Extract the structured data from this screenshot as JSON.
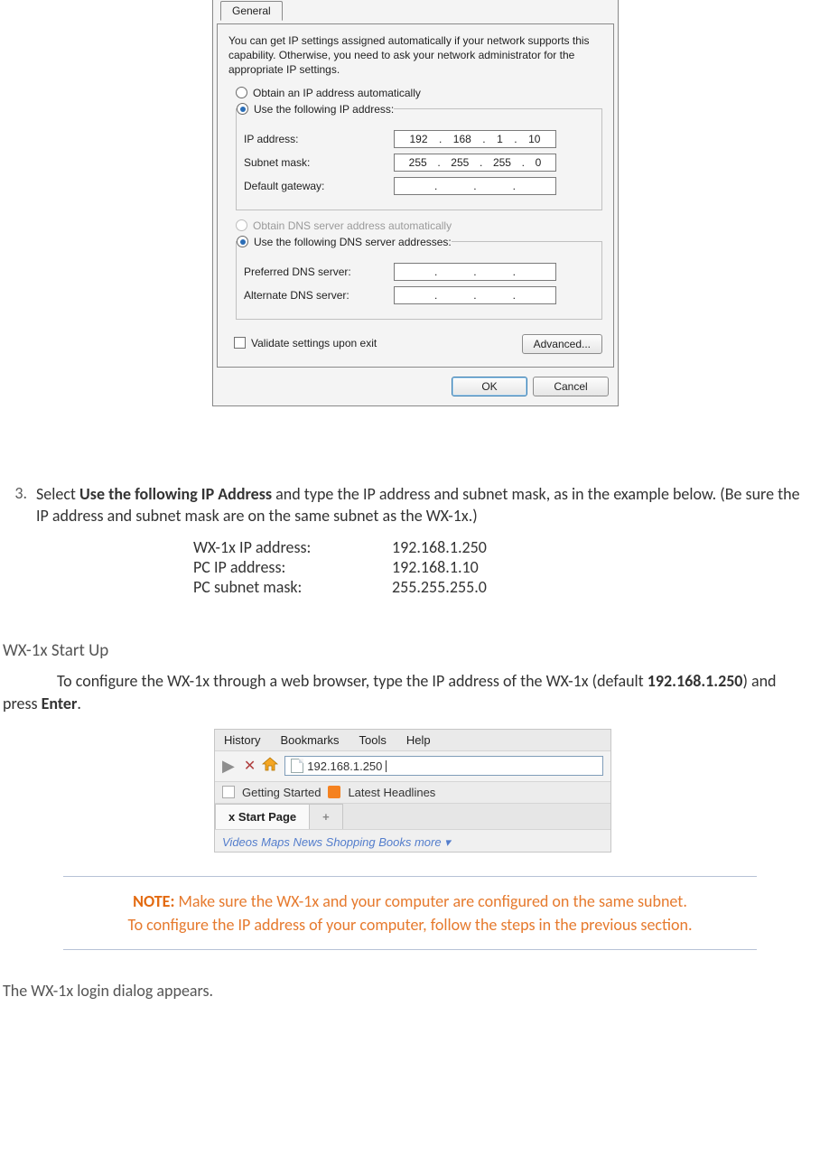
{
  "dialog": {
    "tab": "General",
    "intro": "You can get IP settings assigned automatically if your network supports this capability. Otherwise, you need to ask your network administrator for the appropriate IP settings.",
    "radio_obtain_ip": "Obtain an IP address automatically",
    "radio_use_ip": "Use the following IP address:",
    "ip_label": "IP address:",
    "ip_value_a": "192",
    "ip_value_b": "168",
    "ip_value_c": "1",
    "ip_value_d": "10",
    "subnet_label": "Subnet mask:",
    "subnet_a": "255",
    "subnet_b": "255",
    "subnet_c": "255",
    "subnet_d": "0",
    "gateway_label": "Default gateway:",
    "radio_obtain_dns": "Obtain DNS server address automatically",
    "radio_use_dns": "Use the following DNS server addresses:",
    "pref_dns_label": "Preferred DNS server:",
    "alt_dns_label": "Alternate DNS server:",
    "validate_label": "Validate settings upon exit",
    "advanced_btn": "Advanced...",
    "ok_btn": "OK",
    "cancel_btn": "Cancel"
  },
  "step3": {
    "num": "3.",
    "text_a": "Select ",
    "text_b": "Use the following IP Address",
    "text_c": " and type the IP address and subnet mask, as in the example below. (Be sure the IP address and subnet mask are on the same subnet as the WX-1x.)"
  },
  "table": {
    "r1k": "WX-1x IP address:",
    "r1v": "192.168.1.250",
    "r2k": "PC IP address:",
    "r2v": "192.168.1.10",
    "r3k": "PC subnet mask:",
    "r3v": "255.255.255.0"
  },
  "startup_heading": "WX-1x Start Up",
  "startup_p_a": "To configure the WX-1x through a web browser, type the IP address of the WX-1x (default ",
  "startup_p_b": "192.168.1.250",
  "startup_p_c": ") and press ",
  "startup_p_d": "Enter",
  "startup_p_e": ".",
  "browser": {
    "menu_history": "History",
    "menu_bookmarks": "Bookmarks",
    "menu_tools": "Tools",
    "menu_help": "Help",
    "url": "192.168.1.250",
    "bm1": "Getting Started",
    "bm2": "Latest Headlines",
    "tab1": "x Start Page",
    "tab2": "+",
    "links": "Videos   Maps   News   Shopping   Books   more ▾"
  },
  "note": {
    "label": "NOTE:",
    "l1": " Make sure the WX-1x and your computer are configured on the same subnet.",
    "l2": "To configure the IP address of your computer, follow the steps in the previous section."
  },
  "closing": "The WX-1x login dialog appears."
}
